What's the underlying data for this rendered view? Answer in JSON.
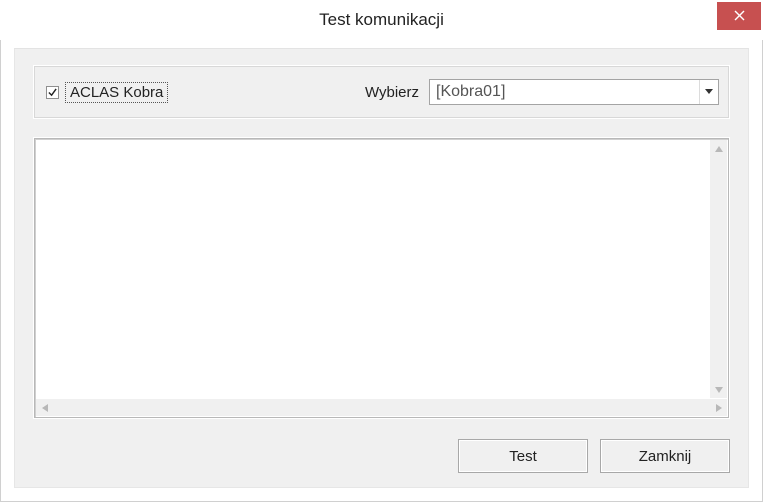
{
  "window": {
    "title": "Test komunikacji"
  },
  "top": {
    "checkbox_label": "ACLAS Kobra",
    "checkbox_checked": true,
    "select_label": "Wybierz",
    "select_value": "[Kobra01]"
  },
  "buttons": {
    "test": "Test",
    "close": "Zamknij"
  }
}
